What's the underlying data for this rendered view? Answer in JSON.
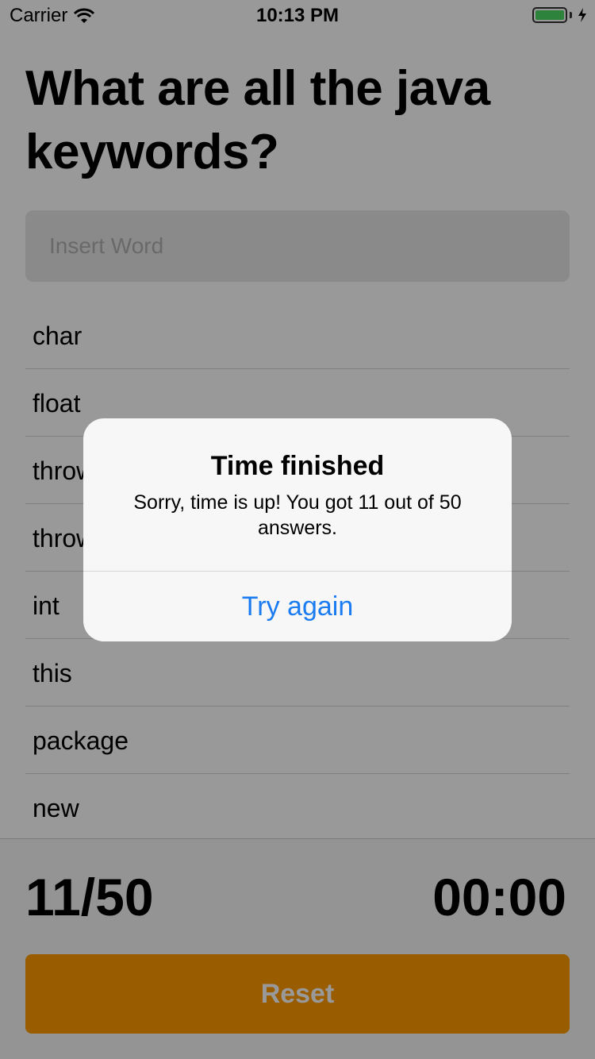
{
  "status_bar": {
    "carrier": "Carrier",
    "time": "10:13 PM"
  },
  "question": "What are all the java keywords?",
  "input": {
    "placeholder": "Insert Word",
    "value": ""
  },
  "words": [
    "char",
    "float",
    "throw",
    "throws",
    "int",
    "this",
    "package",
    "new"
  ],
  "footer": {
    "score": "11/50",
    "timer": "00:00",
    "reset_label": "Reset"
  },
  "alert": {
    "title": "Time finished",
    "message": "Sorry, time is up! You got 11 out of 50 answers.",
    "button_label": "Try again"
  },
  "colors": {
    "accent": "#ff9b00",
    "link": "#1b7cf2",
    "battery": "#4cd964"
  }
}
